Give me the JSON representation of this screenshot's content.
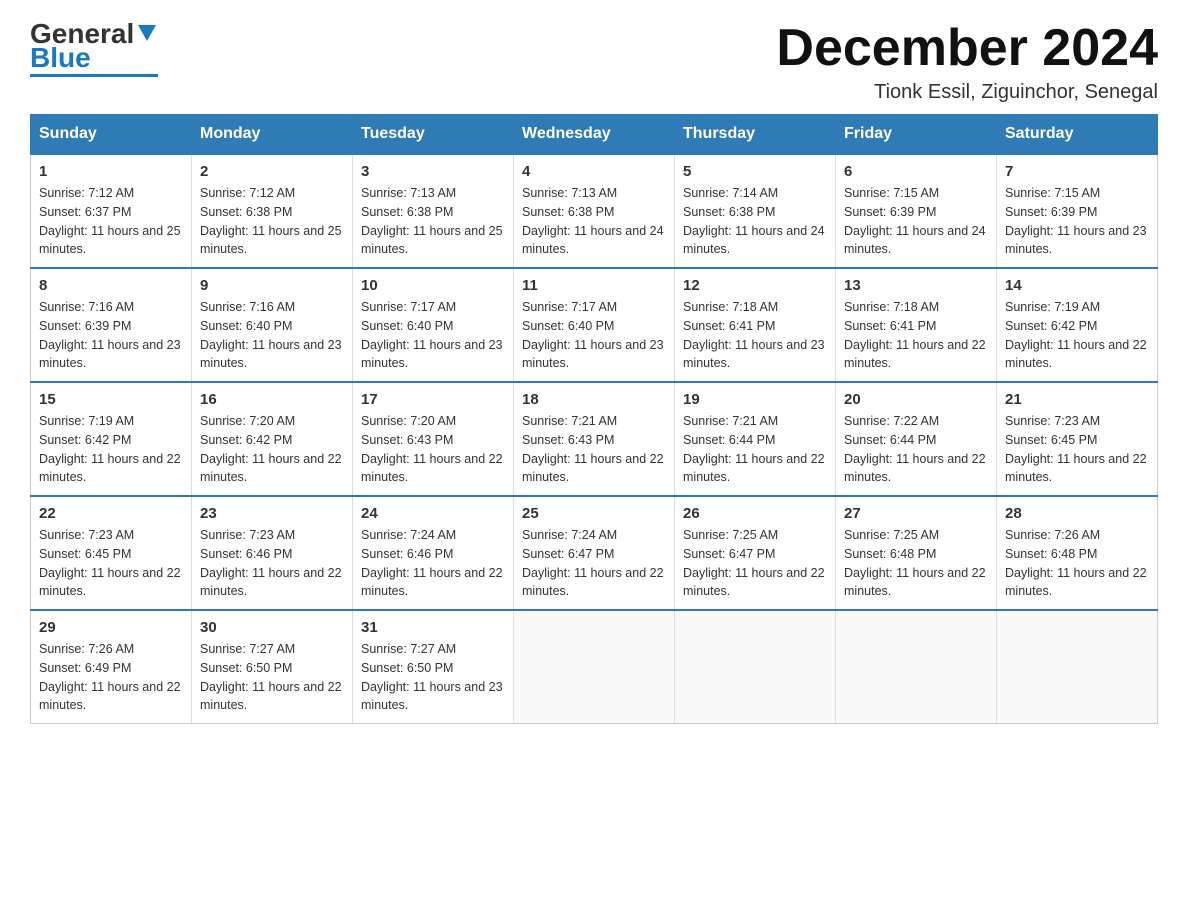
{
  "logo": {
    "general": "General",
    "blue": "Blue"
  },
  "header": {
    "month": "December 2024",
    "location": "Tionk Essil, Ziguinchor, Senegal"
  },
  "days_of_week": [
    "Sunday",
    "Monday",
    "Tuesday",
    "Wednesday",
    "Thursday",
    "Friday",
    "Saturday"
  ],
  "weeks": [
    [
      {
        "day": 1,
        "sunrise": "7:12 AM",
        "sunset": "6:37 PM",
        "daylight": "11 hours and 25 minutes."
      },
      {
        "day": 2,
        "sunrise": "7:12 AM",
        "sunset": "6:38 PM",
        "daylight": "11 hours and 25 minutes."
      },
      {
        "day": 3,
        "sunrise": "7:13 AM",
        "sunset": "6:38 PM",
        "daylight": "11 hours and 25 minutes."
      },
      {
        "day": 4,
        "sunrise": "7:13 AM",
        "sunset": "6:38 PM",
        "daylight": "11 hours and 24 minutes."
      },
      {
        "day": 5,
        "sunrise": "7:14 AM",
        "sunset": "6:38 PM",
        "daylight": "11 hours and 24 minutes."
      },
      {
        "day": 6,
        "sunrise": "7:15 AM",
        "sunset": "6:39 PM",
        "daylight": "11 hours and 24 minutes."
      },
      {
        "day": 7,
        "sunrise": "7:15 AM",
        "sunset": "6:39 PM",
        "daylight": "11 hours and 23 minutes."
      }
    ],
    [
      {
        "day": 8,
        "sunrise": "7:16 AM",
        "sunset": "6:39 PM",
        "daylight": "11 hours and 23 minutes."
      },
      {
        "day": 9,
        "sunrise": "7:16 AM",
        "sunset": "6:40 PM",
        "daylight": "11 hours and 23 minutes."
      },
      {
        "day": 10,
        "sunrise": "7:17 AM",
        "sunset": "6:40 PM",
        "daylight": "11 hours and 23 minutes."
      },
      {
        "day": 11,
        "sunrise": "7:17 AM",
        "sunset": "6:40 PM",
        "daylight": "11 hours and 23 minutes."
      },
      {
        "day": 12,
        "sunrise": "7:18 AM",
        "sunset": "6:41 PM",
        "daylight": "11 hours and 23 minutes."
      },
      {
        "day": 13,
        "sunrise": "7:18 AM",
        "sunset": "6:41 PM",
        "daylight": "11 hours and 22 minutes."
      },
      {
        "day": 14,
        "sunrise": "7:19 AM",
        "sunset": "6:42 PM",
        "daylight": "11 hours and 22 minutes."
      }
    ],
    [
      {
        "day": 15,
        "sunrise": "7:19 AM",
        "sunset": "6:42 PM",
        "daylight": "11 hours and 22 minutes."
      },
      {
        "day": 16,
        "sunrise": "7:20 AM",
        "sunset": "6:42 PM",
        "daylight": "11 hours and 22 minutes."
      },
      {
        "day": 17,
        "sunrise": "7:20 AM",
        "sunset": "6:43 PM",
        "daylight": "11 hours and 22 minutes."
      },
      {
        "day": 18,
        "sunrise": "7:21 AM",
        "sunset": "6:43 PM",
        "daylight": "11 hours and 22 minutes."
      },
      {
        "day": 19,
        "sunrise": "7:21 AM",
        "sunset": "6:44 PM",
        "daylight": "11 hours and 22 minutes."
      },
      {
        "day": 20,
        "sunrise": "7:22 AM",
        "sunset": "6:44 PM",
        "daylight": "11 hours and 22 minutes."
      },
      {
        "day": 21,
        "sunrise": "7:23 AM",
        "sunset": "6:45 PM",
        "daylight": "11 hours and 22 minutes."
      }
    ],
    [
      {
        "day": 22,
        "sunrise": "7:23 AM",
        "sunset": "6:45 PM",
        "daylight": "11 hours and 22 minutes."
      },
      {
        "day": 23,
        "sunrise": "7:23 AM",
        "sunset": "6:46 PM",
        "daylight": "11 hours and 22 minutes."
      },
      {
        "day": 24,
        "sunrise": "7:24 AM",
        "sunset": "6:46 PM",
        "daylight": "11 hours and 22 minutes."
      },
      {
        "day": 25,
        "sunrise": "7:24 AM",
        "sunset": "6:47 PM",
        "daylight": "11 hours and 22 minutes."
      },
      {
        "day": 26,
        "sunrise": "7:25 AM",
        "sunset": "6:47 PM",
        "daylight": "11 hours and 22 minutes."
      },
      {
        "day": 27,
        "sunrise": "7:25 AM",
        "sunset": "6:48 PM",
        "daylight": "11 hours and 22 minutes."
      },
      {
        "day": 28,
        "sunrise": "7:26 AM",
        "sunset": "6:48 PM",
        "daylight": "11 hours and 22 minutes."
      }
    ],
    [
      {
        "day": 29,
        "sunrise": "7:26 AM",
        "sunset": "6:49 PM",
        "daylight": "11 hours and 22 minutes."
      },
      {
        "day": 30,
        "sunrise": "7:27 AM",
        "sunset": "6:50 PM",
        "daylight": "11 hours and 22 minutes."
      },
      {
        "day": 31,
        "sunrise": "7:27 AM",
        "sunset": "6:50 PM",
        "daylight": "11 hours and 23 minutes."
      },
      null,
      null,
      null,
      null
    ]
  ],
  "labels": {
    "sunrise": "Sunrise:",
    "sunset": "Sunset:",
    "daylight": "Daylight:"
  }
}
